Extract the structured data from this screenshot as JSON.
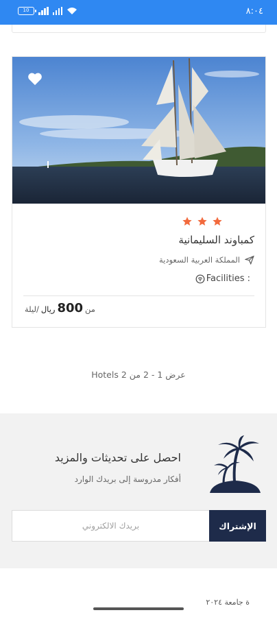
{
  "status_bar": {
    "battery": "10",
    "time": "٨:٠٤",
    "icons": [
      "battery-icon",
      "signal-icon",
      "signal-icon",
      "wifi-icon"
    ],
    "background": "#2f88f2"
  },
  "hotel": {
    "rating_stars": 3,
    "star_color": "#f26a3d",
    "name": "كمباوند السليمانية",
    "location": "المملكة العربية السعودية",
    "facilities_label": "Facilities :",
    "price_from": "من",
    "price_amount": "800",
    "price_currency": "ريال",
    "price_per_night": "/ليلة",
    "favorite_icon": "heart-icon",
    "image_desc_icon": "sailboat-photo"
  },
  "results": {
    "text": "عرض 1 - 2 من 2 Hotels"
  },
  "newsletter": {
    "title": "احصل على تحديثات والمزيد",
    "subtitle": "أفكار مدروسة إلى بريدك الوارد",
    "email_placeholder": "بريدك الالكتروني",
    "subscribe_label": "الإشتراك",
    "button_color": "#1e2b4a"
  },
  "footer": {
    "partial_text": "ة جامعة ٢٠٢٤"
  }
}
